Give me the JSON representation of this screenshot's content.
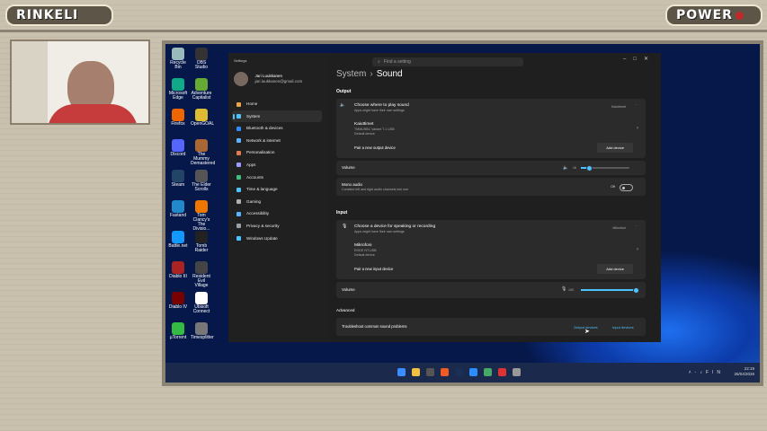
{
  "stream": {
    "logo_left": "RINKELI",
    "logo_right": "POWER"
  },
  "settings": {
    "window_title": "Settings",
    "search_placeholder": "Find a setting",
    "user": {
      "name": "Jari Luukkanen",
      "email": "jari.luukkanen@gmail.com"
    },
    "nav": [
      {
        "label": "Home",
        "color": "#e8a54a"
      },
      {
        "label": "System",
        "color": "#4cc2ff"
      },
      {
        "label": "Bluetooth & devices",
        "color": "#2d8cff"
      },
      {
        "label": "Network & internet",
        "color": "#5bb2ff"
      },
      {
        "label": "Personalisation",
        "color": "#e07a4f"
      },
      {
        "label": "Apps",
        "color": "#9a9aff"
      },
      {
        "label": "Accounts",
        "color": "#3fbf7f"
      },
      {
        "label": "Time & language",
        "color": "#4cc2ff"
      },
      {
        "label": "Gaming",
        "color": "#b0b0b0"
      },
      {
        "label": "Accessibility",
        "color": "#5bb2ff"
      },
      {
        "label": "Privacy & security",
        "color": "#9aa0a8"
      },
      {
        "label": "Windows Update",
        "color": "#4cc2ff"
      }
    ],
    "active_nav": "System",
    "breadcrumb": {
      "parent": "System",
      "current": "Sound"
    },
    "output": {
      "section": "Output",
      "choose_title": "Choose where to play sound",
      "choose_sub": "Apps might have their own settings",
      "choose_value": "Kaiuttimet",
      "device_name": "Kaiuttimet",
      "device_desc": "TMMUSBC Variant 7.1 USB",
      "device_default": "Default device",
      "pair_label": "Pair a new output device",
      "add_button": "Add device",
      "volume_label": "Volume",
      "volume_value": "16",
      "mono_title": "Mono audio",
      "mono_sub": "Combine left and right audio channels into one",
      "mono_state": "Off"
    },
    "input": {
      "section": "Input",
      "choose_title": "Choose a device for speaking or recording",
      "choose_sub": "Apps might have their own settings",
      "choose_value": "Mikrofoni",
      "device_name": "Mikrofoni",
      "device_desc": "RODE NT-USB",
      "device_default": "Default device",
      "pair_label": "Pair a new input device",
      "add_button": "Add device",
      "volume_label": "Volume",
      "volume_value": "100"
    },
    "advanced": {
      "section": "Advanced",
      "troubleshoot": "Troubleshoot common sound problems",
      "output_link": "Output devices",
      "input_link": "Input devices"
    }
  },
  "desktop_icons": [
    {
      "label": "Recycle Bin",
      "color": "#9bb"
    },
    {
      "label": "OBS Studio",
      "color": "#333"
    },
    {
      "label": "Microsoft Edge",
      "color": "#1a8"
    },
    {
      "label": "Adventure Capitalist",
      "color": "#6a3"
    },
    {
      "label": "Firefox",
      "color": "#e60"
    },
    {
      "label": "OpenGOAL",
      "color": "#db3"
    },
    {
      "label": "Discord",
      "color": "#56f"
    },
    {
      "label": "The Mummy Demastered",
      "color": "#a63"
    },
    {
      "label": "Steam",
      "color": "#246"
    },
    {
      "label": "The Elder Scrolls",
      "color": "#555"
    },
    {
      "label": "Fastand",
      "color": "#28c"
    },
    {
      "label": "Tom Clancy's The Divisio...",
      "color": "#e70"
    },
    {
      "label": "Battle.net",
      "color": "#19f"
    },
    {
      "label": "Tomb Raider",
      "color": "#222"
    },
    {
      "label": "Diablo III",
      "color": "#a22"
    },
    {
      "label": "Resident Evil Village",
      "color": "#444"
    },
    {
      "label": "Diablo IV",
      "color": "#700"
    },
    {
      "label": "Ubisoft Connect",
      "color": "#fff"
    },
    {
      "label": "µTorrent",
      "color": "#3b4"
    },
    {
      "label": "Timesplitter",
      "color": "#777"
    }
  ],
  "tray": {
    "lang": "FIN",
    "time": "22:19",
    "date": "26/04/2026"
  }
}
